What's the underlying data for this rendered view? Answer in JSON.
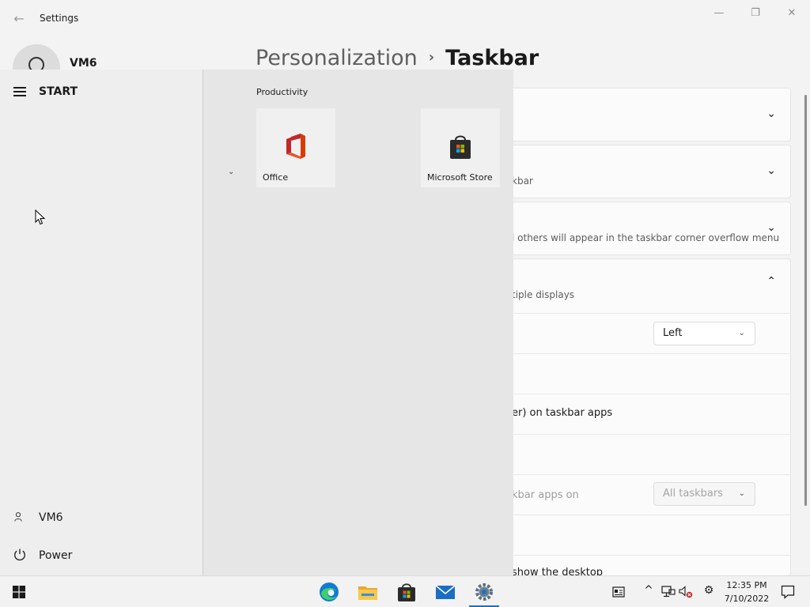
{
  "window": {
    "app_title": "Settings",
    "back_glyph": "←",
    "min_glyph": "—",
    "max_glyph": "❐",
    "close_glyph": "✕"
  },
  "profile": {
    "name": "VM6"
  },
  "breadcrumb": {
    "parent": "Personalization",
    "separator": "›",
    "current": "Taskbar"
  },
  "settings_rows": {
    "row2_desc": "kbar",
    "row3_desc": "l others will appear in the taskbar corner overflow menu",
    "row4_desc": "tiple displays",
    "alignment_value": "Left",
    "hover_row": "er) on taskbar apps",
    "show_apps_row": "kbar apps on",
    "show_apps_value": "All taskbars",
    "desktop_row": "show the desktop",
    "chev_down": "⌄",
    "chev_up": "⌃",
    "dd_chev": "⌄"
  },
  "start_menu": {
    "label": "START",
    "user": "VM6",
    "power": "Power",
    "group_title": "Productivity",
    "group_chev": "⌄",
    "tiles": [
      {
        "label": "Office"
      },
      {
        "label": "Microsoft Store"
      }
    ]
  },
  "taskbar": {
    "time": "12:35 PM",
    "date": "7/10/2022",
    "tray": {
      "chevron": "^",
      "gear": "⚙",
      "notif": "🗨"
    }
  },
  "colors": {
    "accent": "#1f6fbf",
    "office_red": "#d83b01",
    "store_dark": "#2b2b2b"
  }
}
